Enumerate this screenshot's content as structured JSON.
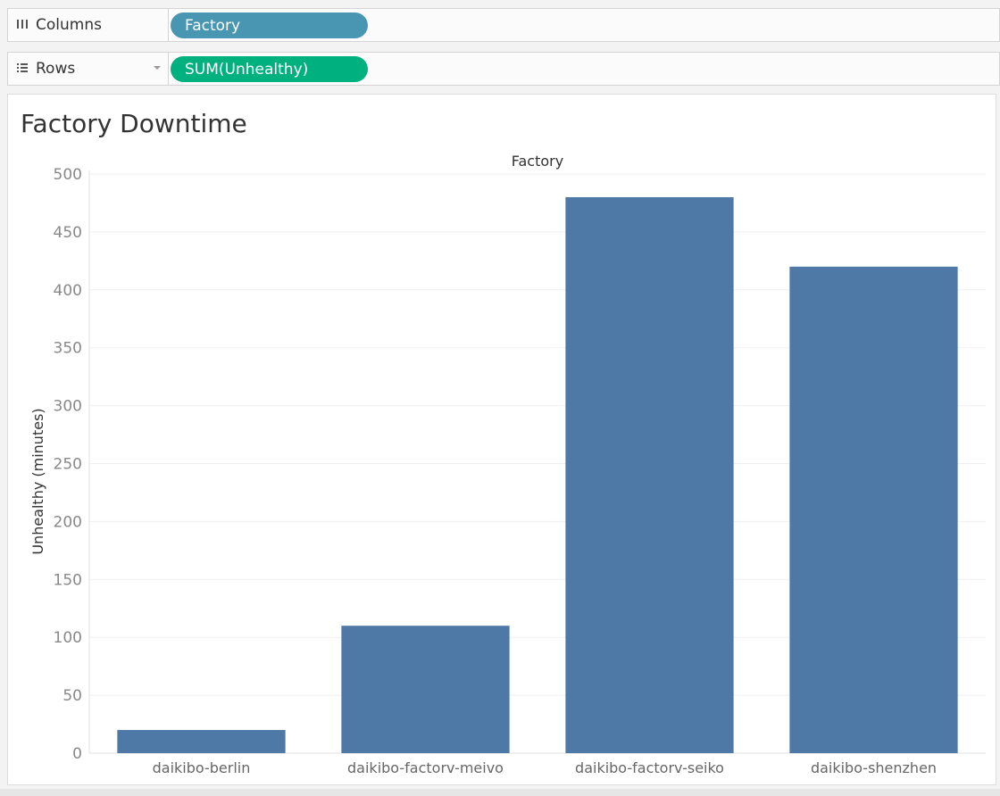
{
  "shelves": {
    "columns": {
      "label": "Columns",
      "icon": "columns-icon",
      "pill": "Factory",
      "pill_color": "#4996b2"
    },
    "rows": {
      "label": "Rows",
      "icon": "rows-icon",
      "pill": "SUM(Unhealthy)",
      "pill_color": "#00b180"
    }
  },
  "chart_data": {
    "type": "bar",
    "title": "Factory Downtime",
    "xlabel": "Factory",
    "ylabel": "Unhealthy (minutes)",
    "categories": [
      "daikibo-berlin",
      "daikibo-factorv-meivo",
      "daikibo-factorv-seiko",
      "daikibo-shenzhen"
    ],
    "values": [
      20,
      110,
      480,
      420
    ],
    "ylim": [
      0,
      500
    ],
    "yticks": [
      0,
      50,
      100,
      150,
      200,
      250,
      300,
      350,
      400,
      450,
      500
    ],
    "bar_color": "#4e79a7",
    "grid": true,
    "legend": "none"
  }
}
